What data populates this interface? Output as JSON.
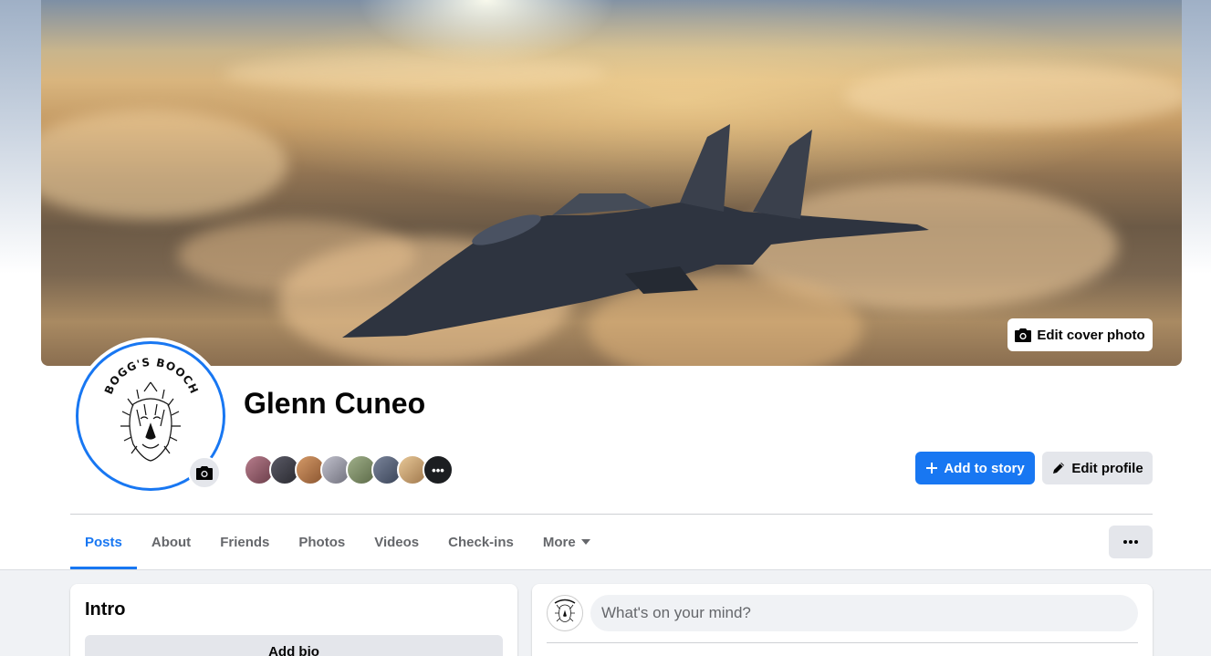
{
  "cover": {
    "edit_cover_label": "Edit cover photo"
  },
  "profile": {
    "name": "Glenn Cuneo",
    "avatar_text": "BOGG'S BOOCH",
    "friend_avatars": [
      "#a86b7a",
      "#4a4a55",
      "#c58a5a",
      "#9a9aa6",
      "#7c8a6a",
      "#5a6478",
      "#d0a878"
    ],
    "friend_more": "•••"
  },
  "actions": {
    "add_to_story": "Add to story",
    "edit_profile": "Edit profile"
  },
  "tabs": [
    {
      "label": "Posts",
      "active": true
    },
    {
      "label": "About",
      "active": false
    },
    {
      "label": "Friends",
      "active": false
    },
    {
      "label": "Photos",
      "active": false
    },
    {
      "label": "Videos",
      "active": false
    },
    {
      "label": "Check-ins",
      "active": false
    },
    {
      "label": "More",
      "active": false
    }
  ],
  "intro": {
    "title": "Intro",
    "add_bio": "Add bio"
  },
  "composer": {
    "placeholder": "What's on your mind?"
  },
  "colors": {
    "accent": "#1877f2",
    "secondary_button": "#e4e6eb",
    "page_bg": "#f0f2f5"
  }
}
